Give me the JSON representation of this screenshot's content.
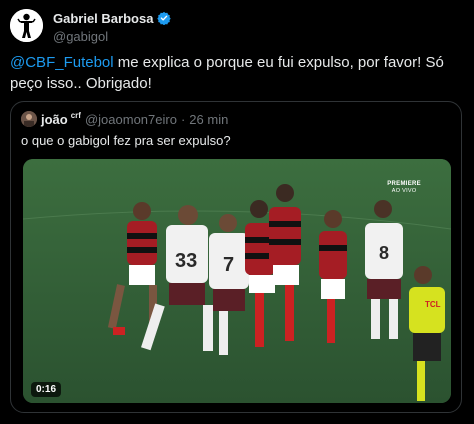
{
  "tweet": {
    "author_name": "Gabriel Barbosa",
    "author_handle": "@gabigol",
    "verified_icon": "verified-badge-icon",
    "text_mention": "@CBF_Futebol",
    "text_body": " me explica o porque eu fui expulso, por favor! Só peço isso.. Obrigado!"
  },
  "quote": {
    "author_name": "joão",
    "author_badge": "crf",
    "author_handle": "@joaomon7eiro",
    "separator": "·",
    "time": "26 min",
    "text": "o que o gabigol fez pra ser expulso?",
    "video": {
      "duration": "0:16",
      "watermark_title": "PREMIERE",
      "watermark_subtitle": "AO VIVO"
    }
  },
  "colors": {
    "background": "#000000",
    "text": "#e7e9ea",
    "secondary": "#71767b",
    "link": "#1d9bf0",
    "border": "#2f3336"
  }
}
